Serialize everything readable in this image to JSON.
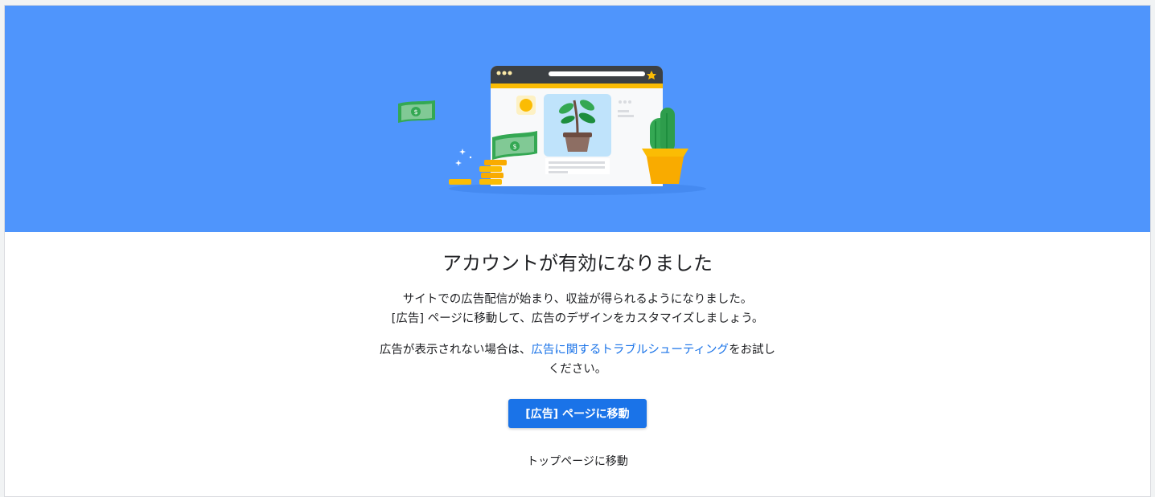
{
  "colors": {
    "hero_bg": "#4f95fc",
    "primary_button": "#1a73e8",
    "link": "#1a73e8"
  },
  "illustration": {
    "browser_window": "browser-window-icon",
    "plant": "potted-plant-icon",
    "cactus": "cactus-icon",
    "money": "dollar-bill-icon",
    "coins": "coin-stack-icon"
  },
  "main": {
    "title": "アカウントが有効になりました",
    "desc_line1": "サイトでの広告配信が始まり、収益が得られるようになりました。",
    "desc_line2": "[広告] ページに移動して、広告のデザインをカスタマイズしましょう。",
    "trouble_prefix": "広告が表示されない場合は、",
    "trouble_link": "広告に関するトラブルシューティング",
    "trouble_suffix": "をお試しください。",
    "primary_button": "[広告] ページに移動",
    "secondary_link": "トップページに移動"
  }
}
